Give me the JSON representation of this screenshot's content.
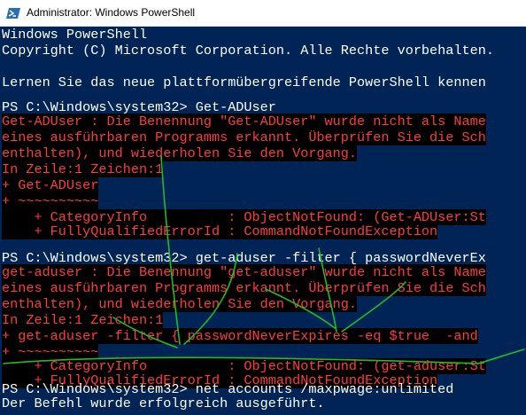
{
  "window": {
    "title": "Administrator: Windows PowerShell",
    "icon": "powershell-icon"
  },
  "colors": {
    "console_bg": "#012456",
    "text": "#ffffff",
    "error_text": "#ff3b3b",
    "error_bg": "#000000",
    "annotation_stroke": "#22bb22"
  },
  "console": {
    "lines": [
      "Windows PowerShell",
      "Copyright (C) Microsoft Corporation. Alle Rechte vorbehalten.",
      "",
      "Lernen Sie das neue plattformübergreifende PowerShell kennen",
      "",
      "PS C:\\Windows\\system32> Get-ADUser",
      "Get-ADUser : Die Benennung \"Get-ADUser\" wurde nicht als Name",
      "eines ausführbaren Programms erkannt. Überprüfen Sie die Sch",
      "enthalten), und wiederholen Sie den Vorgang.",
      "In Zeile:1 Zeichen:1",
      "+ Get-ADUser",
      "+ ~~~~~~~~~~",
      "    + CategoryInfo          : ObjectNotFound: (Get-ADUser:St",
      "    + FullyQualifiedErrorId : CommandNotFoundException",
      "",
      "PS C:\\Windows\\system32> get-aduser -filter { passwordNeverEx",
      "get-aduser : Die Benennung \"get-aduser\" wurde nicht als Name",
      "eines ausführbaren Programms erkannt. Überprüfen Sie die Sch",
      "enthalten), und wiederholen Sie den Vorgang.",
      "In Zeile:1 Zeichen:1",
      "+ get-aduser -filter { passwordNeverExpires -eq $true  -and",
      "+ ~~~~~~~~~~",
      "    + CategoryInfo          : ObjectNotFound: (get-aduser:St",
      "    + FullyQualifiedErrorId : CommandNotFoundException",
      "",
      "PS C:\\Windows\\system32> net accounts /maxpwage:unlimited",
      "Der Befehl wurde erfolgreich ausgeführt."
    ]
  }
}
